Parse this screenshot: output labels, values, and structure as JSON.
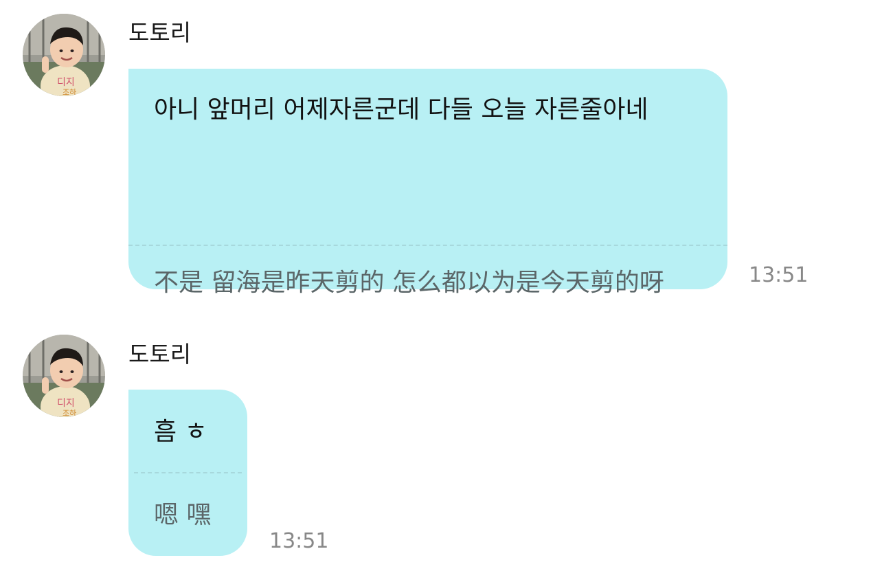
{
  "messages": [
    {
      "sender": "도토리",
      "original": "아니 앞머리 어제자른군데 다들 오늘 자른줄아네",
      "translation": "不是 留海是昨天剪的 怎么都以为是今天剪的呀",
      "time": "13:51"
    },
    {
      "sender": "도토리",
      "original": "흠 ㅎ",
      "translation": "嗯 嘿",
      "time": "13:51"
    }
  ],
  "colors": {
    "bubble": "#b8f0f4",
    "divider": "#a7d8dc",
    "original_text": "#121212",
    "translation_text": "#5b6668",
    "time_text": "#888888"
  },
  "icons": {
    "avatar": "profile-photo-avatar"
  }
}
